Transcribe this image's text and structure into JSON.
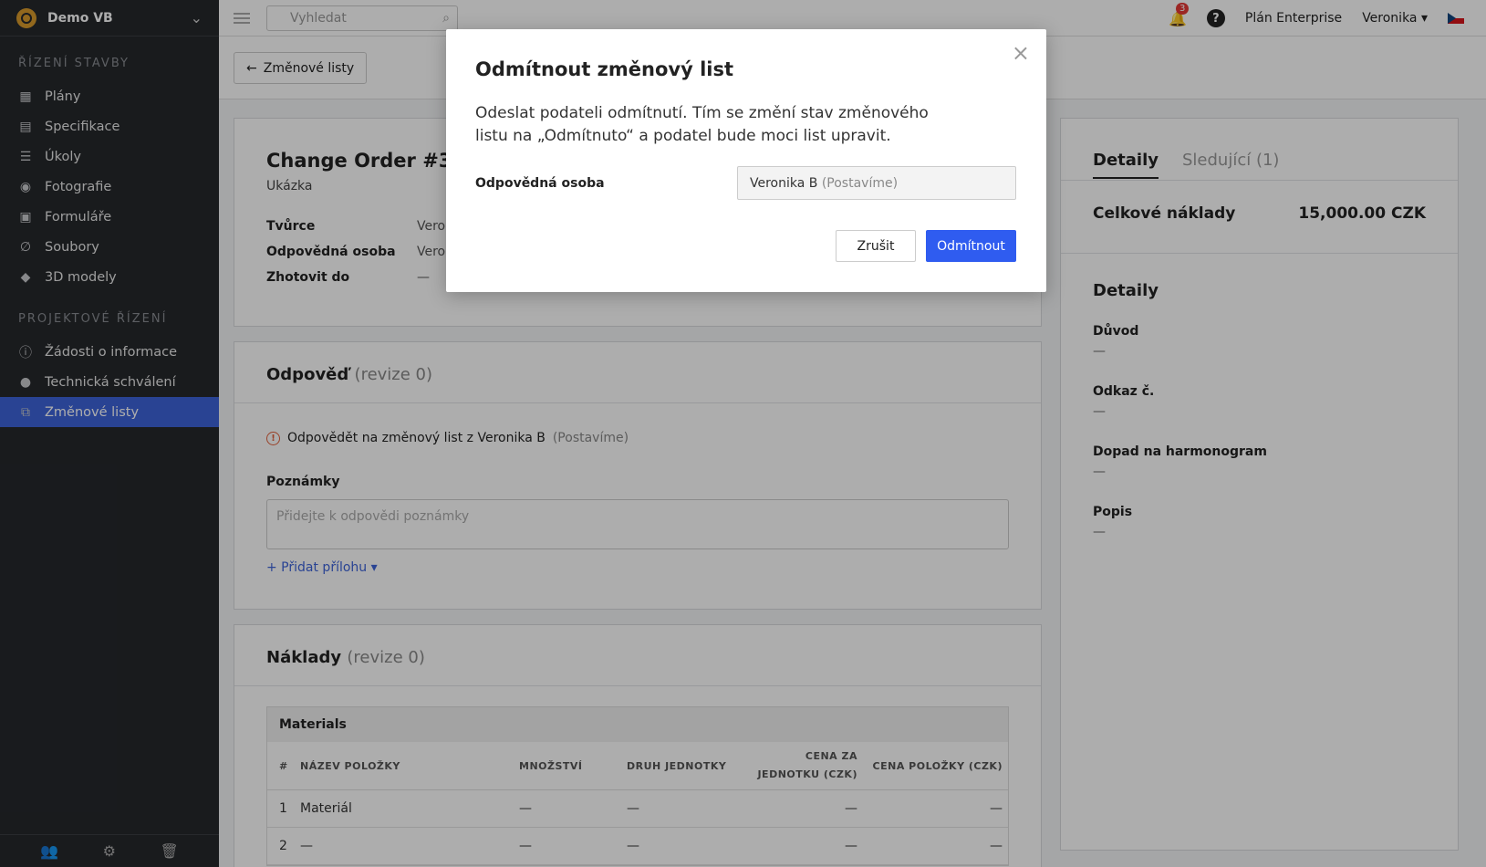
{
  "sidebar": {
    "company": "Demo VB",
    "section1": "ŘÍZENÍ STAVBY",
    "items1": [
      {
        "label": "Plány"
      },
      {
        "label": "Specifikace"
      },
      {
        "label": "Úkoly"
      },
      {
        "label": "Fotografie"
      },
      {
        "label": "Formuláře"
      },
      {
        "label": "Soubory"
      },
      {
        "label": "3D modely"
      }
    ],
    "section2": "PROJEKTOVÉ ŘÍZENÍ",
    "items2": [
      {
        "label": "Žádosti o informace"
      },
      {
        "label": "Technická schválení"
      },
      {
        "label": "Změnové listy"
      }
    ]
  },
  "topbar": {
    "search_placeholder": "Vyhledat",
    "notifications": "3",
    "plan": "Plán Enterprise",
    "user": "Veronika"
  },
  "back_label": "Změnové listy",
  "order": {
    "title": "Change Order #3-00",
    "subtitle": "Ukázka",
    "meta": [
      {
        "k": "Tvůrce",
        "v": "Vero"
      },
      {
        "k": "Odpovědná osoba",
        "v": "Vero"
      },
      {
        "k": "Zhotovit do",
        "v": "—"
      }
    ]
  },
  "response": {
    "title": "Odpověď",
    "rev": "(revize 0)",
    "notice": "Odpovědět na změnový list z Veronika B",
    "notice_company": "(Postavíme)",
    "notes_label": "Poznámky",
    "notes_placeholder": "Přidejte k odpovědi poznámky",
    "attach": "+ Přidat přílohu"
  },
  "costs": {
    "title": "Náklady",
    "rev": "(revize 0)",
    "group": "Materials",
    "headers": [
      "#",
      "NÁZEV POLOŽKY",
      "MNOŽSTVÍ",
      "DRUH JEDNOTKY",
      "CENA ZA JEDNOTKU (CZK)",
      "CENA POLOŽKY (CZK)"
    ],
    "rows": [
      [
        "1",
        "Materiál",
        "—",
        "—",
        "—",
        "—"
      ],
      [
        "2",
        "—",
        "—",
        "—",
        "—",
        "—"
      ]
    ]
  },
  "details": {
    "tab1": "Detaily",
    "tab2": "Sledující (1)",
    "total_label": "Celkové náklady",
    "total_value": "15,000.00 CZK",
    "section": "Detaily",
    "fields": [
      {
        "k": "Důvod",
        "v": "—"
      },
      {
        "k": "Odkaz č.",
        "v": "—"
      },
      {
        "k": "Dopad na harmonogram",
        "v": "—"
      },
      {
        "k": "Popis",
        "v": "—"
      }
    ]
  },
  "modal": {
    "title": "Odmítnout změnový list",
    "text": "Odeslat podateli odmítnutí. Tím se změní stav změnového listu na „Odmítnuto“ a podatel bude moci list upravit.",
    "label": "Odpovědná osoba",
    "person": "Veronika B",
    "company": "(Postavíme)",
    "cancel": "Zrušit",
    "reject": "Odmítnout"
  },
  "colors": {
    "accent": "#2f5cf0",
    "sidebar": "#25282c",
    "active": "#3d63d9"
  }
}
